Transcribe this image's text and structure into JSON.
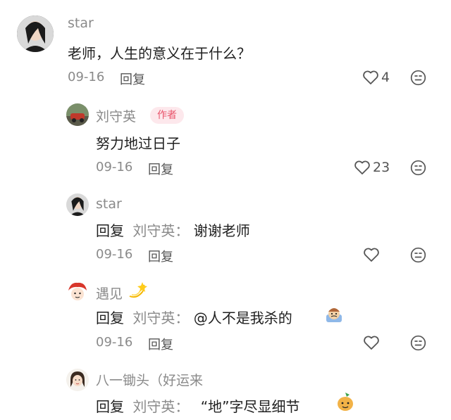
{
  "comments": [
    {
      "author": "star",
      "text": "老师，人生的意义在于什么？",
      "date": "09-16",
      "reply_label": "回复",
      "like_count": "4"
    }
  ],
  "replies": [
    {
      "author": "刘守英",
      "badge": "作者",
      "text": "努力地过日子",
      "date": "09-16",
      "reply_label": "回复",
      "like_count": "23"
    },
    {
      "author": "star",
      "reply_prefix": "回复",
      "reply_target": "刘守英：",
      "text": "谢谢老师",
      "date": "09-16",
      "reply_label": "回复",
      "like_count": ""
    },
    {
      "author": "遇见",
      "reply_prefix": "回复",
      "reply_target": "刘守英：",
      "text": "@人不是我杀的",
      "date": "09-16",
      "reply_label": "回复",
      "like_count": ""
    },
    {
      "author": "八一锄头（好运来",
      "reply_prefix": "回复",
      "reply_target": "刘守英：",
      "text": "“地”字尽显细节"
    }
  ],
  "icons": {
    "like": "heart-outline-icon",
    "more": "emoji-face-icon",
    "sparkle": "dizzy-star-icon"
  },
  "colors": {
    "badge_bg": "#fde8ec",
    "badge_text": "#e9546b",
    "muted": "#8a8a8a"
  }
}
